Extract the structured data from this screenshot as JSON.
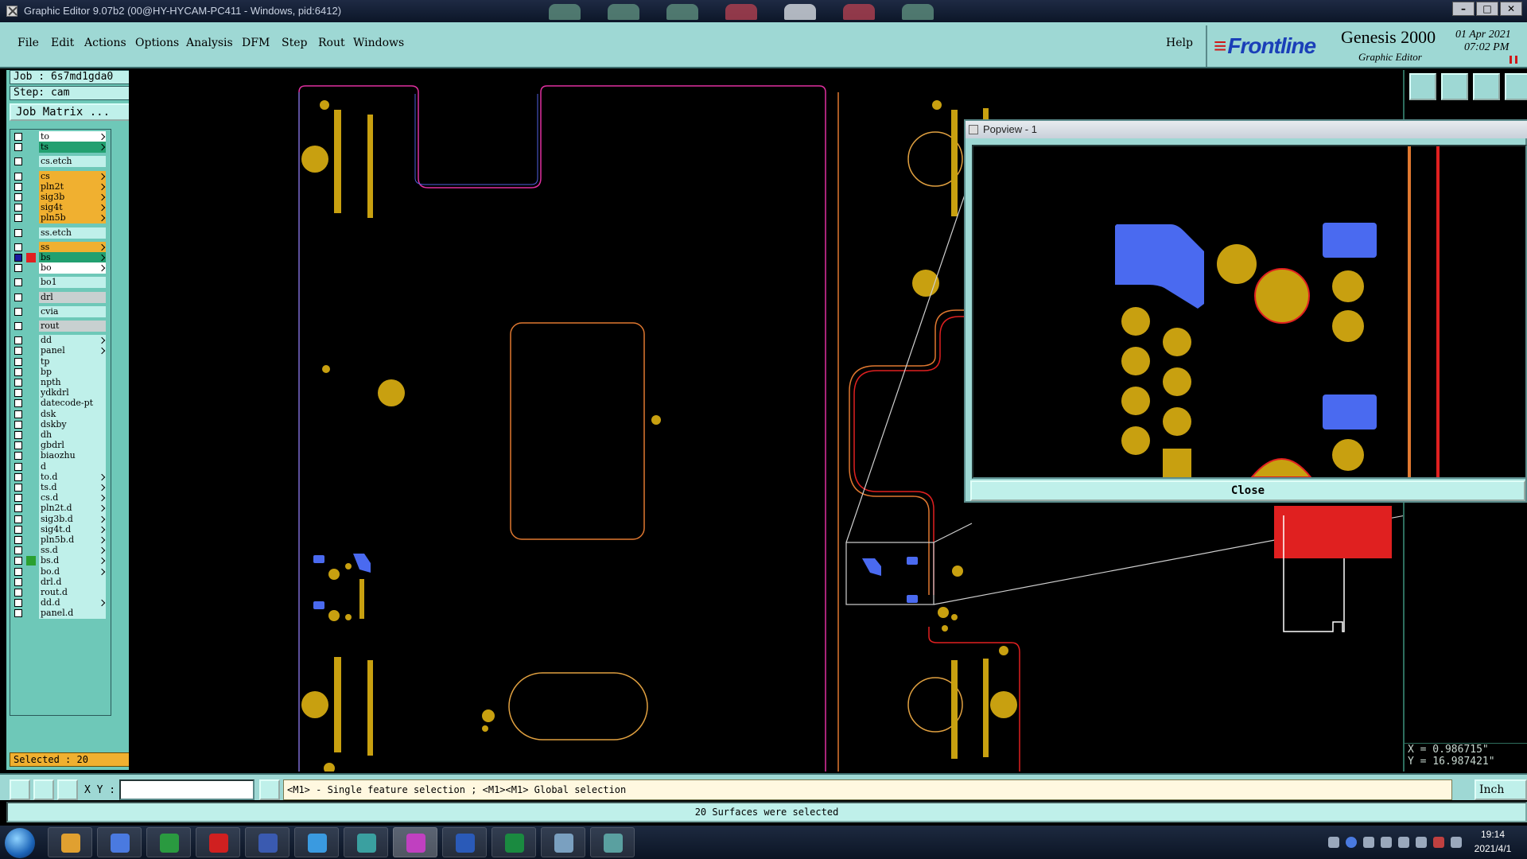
{
  "window": {
    "title": "Graphic Editor 9.07b2 (00@HY-HYCAM-PC411 - Windows, pid:6412)",
    "min": "–",
    "max": "□",
    "close": "✕"
  },
  "menu": {
    "items": [
      "File",
      "Edit",
      "Actions",
      "Options",
      "Analysis",
      "DFM",
      "Step",
      "Rout",
      "Windows"
    ],
    "help": "Help"
  },
  "brand": {
    "logo": "Frontline",
    "product": "Genesis 2000",
    "subtitle": "Graphic Editor",
    "date": "01 Apr 2021",
    "time": "07:02 PM"
  },
  "job": {
    "job_label": "Job : 6s7md1gda0",
    "step_label": "Step: cam",
    "matrix_button": "Job Matrix ..."
  },
  "layers": [
    {
      "name": "to",
      "color": "white",
      "arrow": true
    },
    {
      "name": "ts",
      "color": "green",
      "arrow": true
    },
    {
      "name": "cs.etch",
      "color": "plain",
      "arrow": false,
      "gap": true
    },
    {
      "name": "cs",
      "color": "yellow",
      "arrow": true,
      "gap": true
    },
    {
      "name": "pln2t",
      "color": "yellow",
      "arrow": true
    },
    {
      "name": "sig3b",
      "color": "yellow",
      "arrow": true
    },
    {
      "name": "sig4t",
      "color": "yellow",
      "arrow": true
    },
    {
      "name": "pln5b",
      "color": "yellow",
      "arrow": true
    },
    {
      "name": "ss.etch",
      "color": "plain",
      "arrow": false,
      "gap": true
    },
    {
      "name": "ss",
      "color": "yellow",
      "arrow": true,
      "gap": true
    },
    {
      "name": "bs",
      "color": "green",
      "arrow": true,
      "work": true
    },
    {
      "name": "bo",
      "color": "white",
      "arrow": true
    },
    {
      "name": "bo1",
      "color": "plain",
      "arrow": false,
      "gap": true
    },
    {
      "name": "drl",
      "color": "grey",
      "arrow": false,
      "gap": true
    },
    {
      "name": "cvia",
      "color": "plain",
      "arrow": false,
      "gap": true
    },
    {
      "name": "rout",
      "color": "grey",
      "arrow": false,
      "gap": true
    },
    {
      "name": "dd",
      "color": "plain",
      "arrow": true,
      "gap": true
    },
    {
      "name": "panel",
      "color": "plain",
      "arrow": true
    },
    {
      "name": "tp",
      "color": "plain",
      "arrow": false
    },
    {
      "name": "bp",
      "color": "plain",
      "arrow": false
    },
    {
      "name": "npth",
      "color": "plain",
      "arrow": false
    },
    {
      "name": "ydkdrl",
      "color": "plain",
      "arrow": false
    },
    {
      "name": "datecode-pt",
      "color": "plain",
      "arrow": false
    },
    {
      "name": "dsk",
      "color": "plain",
      "arrow": false
    },
    {
      "name": "dskby",
      "color": "plain",
      "arrow": false
    },
    {
      "name": "dh",
      "color": "plain",
      "arrow": false
    },
    {
      "name": "gbdrl",
      "color": "plain",
      "arrow": false
    },
    {
      "name": "biaozhu",
      "color": "plain",
      "arrow": false
    },
    {
      "name": "d",
      "color": "plain",
      "arrow": false
    },
    {
      "name": "to.d",
      "color": "plain",
      "arrow": true
    },
    {
      "name": "ts.d",
      "color": "plain",
      "arrow": true
    },
    {
      "name": "cs.d",
      "color": "plain",
      "arrow": true
    },
    {
      "name": "pln2t.d",
      "color": "plain",
      "arrow": true
    },
    {
      "name": "sig3b.d",
      "color": "plain",
      "arrow": true
    },
    {
      "name": "sig4t.d",
      "color": "plain",
      "arrow": true
    },
    {
      "name": "pln5b.d",
      "color": "plain",
      "arrow": true
    },
    {
      "name": "ss.d",
      "color": "plain",
      "arrow": true
    },
    {
      "name": "bs.d",
      "color": "plain",
      "arrow": true,
      "greenmark": true
    },
    {
      "name": "bo.d",
      "color": "plain",
      "arrow": true
    },
    {
      "name": "drl.d",
      "color": "plain",
      "arrow": false
    },
    {
      "name": "rout.d",
      "color": "plain",
      "arrow": false
    },
    {
      "name": "dd.d",
      "color": "plain",
      "arrow": true
    },
    {
      "name": "panel.d",
      "color": "plain",
      "arrow": false
    }
  ],
  "selection": {
    "label": "Selected : 20"
  },
  "popview": {
    "title": "Popview - 1",
    "close": "Close"
  },
  "coords": {
    "x": "X = 0.986715\"",
    "y": "Y = 16.987421\""
  },
  "command": {
    "xy_label": "X Y :",
    "xy_value": "",
    "hint": "<M1> - Single feature selection ; <M1><M1> Global selection",
    "units": "Inch"
  },
  "status": "20 Surfaces were selected",
  "clock": {
    "time": "19:14",
    "date": "2021/4/1"
  },
  "colors": {
    "pad": "#c8a010",
    "surface": "#4a6af0",
    "outline_orange": "#e07830",
    "outline_red": "#e02020",
    "outline_pink": "#e030a0",
    "panel_bg": "#9ed8d4"
  }
}
